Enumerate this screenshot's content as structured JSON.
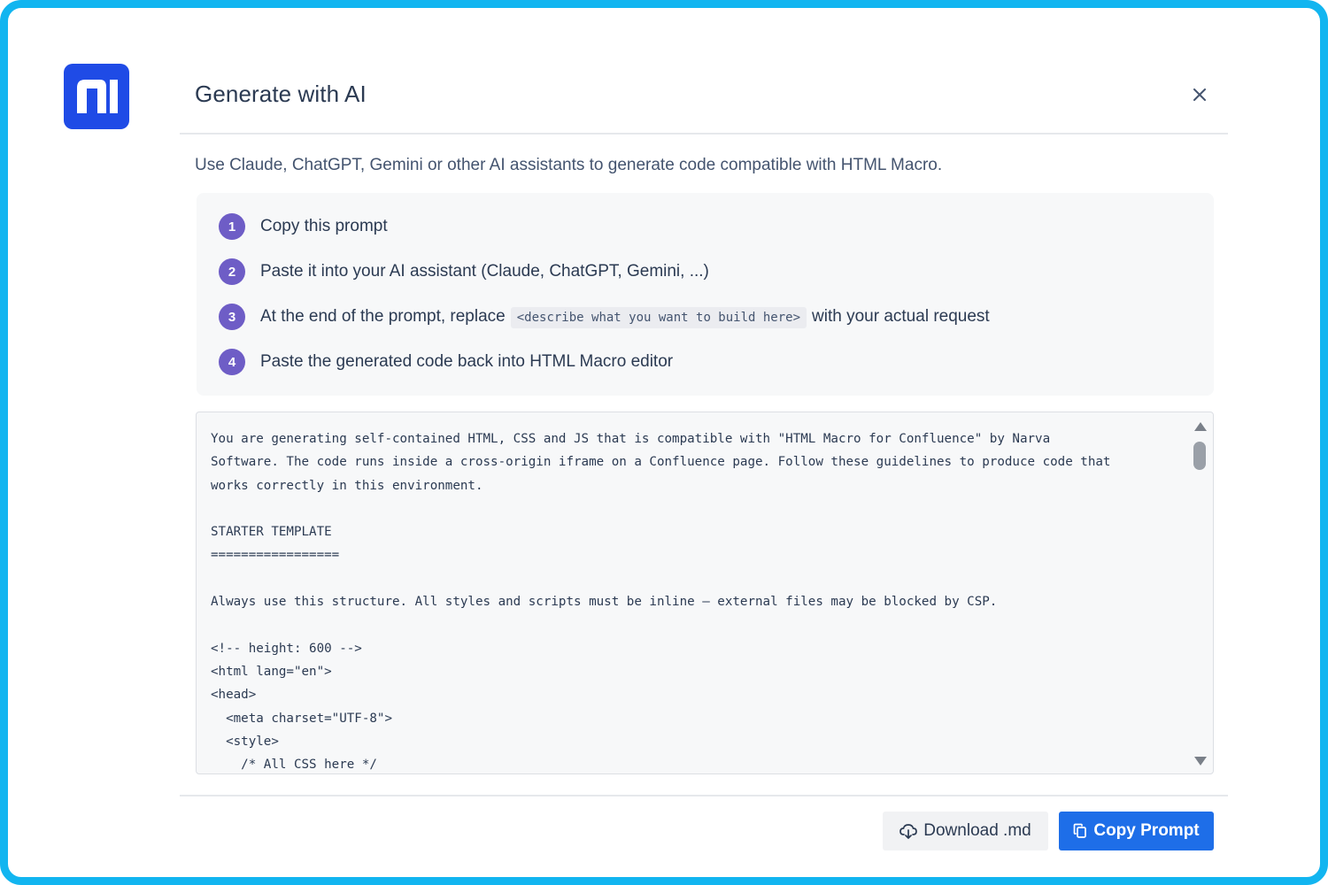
{
  "dialog": {
    "title": "Generate with AI",
    "subtitle": "Use Claude, ChatGPT, Gemini or other AI assistants to generate code compatible with HTML Macro."
  },
  "steps": [
    {
      "number": "1",
      "text": "Copy this prompt"
    },
    {
      "number": "2",
      "text": "Paste it into your AI assistant (Claude, ChatGPT, Gemini, ...)"
    },
    {
      "number": "3",
      "text_before": "At the end of the prompt, replace",
      "code": "<describe what you want to build here>",
      "text_after": "with your actual request"
    },
    {
      "number": "4",
      "text": "Paste the generated code back into HTML Macro editor"
    }
  ],
  "prompt_text": "You are generating self-contained HTML, CSS and JS that is compatible with \"HTML Macro for Confluence\" by Narva\nSoftware. The code runs inside a cross-origin iframe on a Confluence page. Follow these guidelines to produce code that\nworks correctly in this environment.\n\nSTARTER TEMPLATE\n=================\n\nAlways use this structure. All styles and scripts must be inline — external files may be blocked by CSP.\n\n<!-- height: 600 -->\n<html lang=\"en\">\n<head>\n  <meta charset=\"UTF-8\">\n  <style>\n    /* All CSS here */",
  "footer": {
    "download_label": "Download .md",
    "copy_label": "Copy Prompt"
  },
  "icons": {
    "logo": "narva-logo-icon",
    "close": "close-icon",
    "download": "cloud-download-icon",
    "copy": "copy-icon"
  },
  "colors": {
    "frame_border": "#12b5f0",
    "logo_bg": "#1f4be6",
    "step_badge": "#6e5dc6",
    "primary_button": "#1e6ee8"
  }
}
